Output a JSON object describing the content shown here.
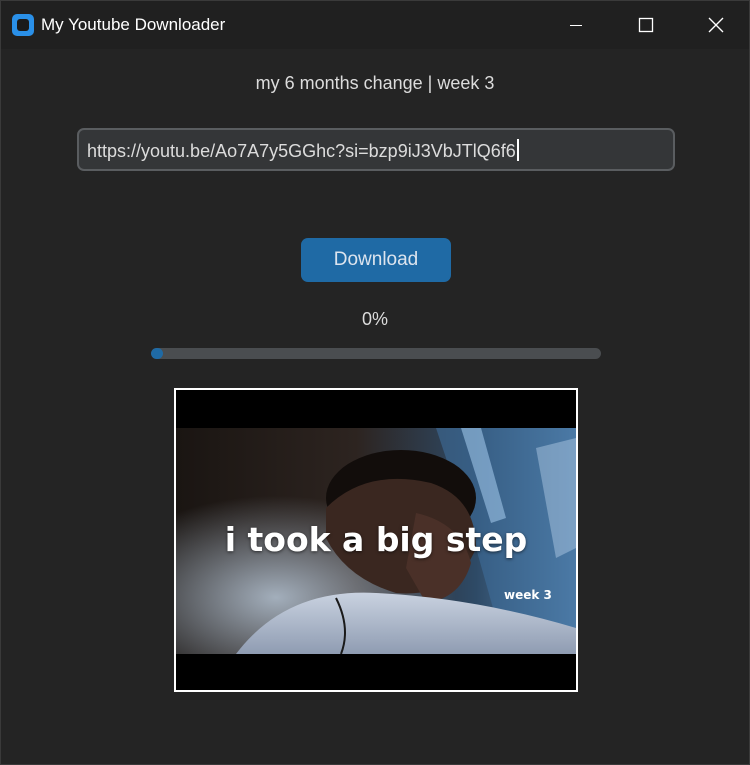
{
  "window": {
    "title": "My Youtube Downloader",
    "icon": "app-icon",
    "controls": [
      "minimize-icon",
      "maximize-icon",
      "close-icon"
    ]
  },
  "video": {
    "title": "my 6 months change | week 3"
  },
  "url_input": {
    "value": "https://youtu.be/Ao7A7y5GGhc?si=bzp9iJ3VbJTlQ6f6"
  },
  "download_button": {
    "label": "Download"
  },
  "progress": {
    "label": "0%",
    "value": 0
  },
  "thumbnail": {
    "caption": "i took a big step",
    "tag": "week 3"
  },
  "colors": {
    "background": "#242424",
    "titlebar": "#202020",
    "accent": "#1f6aa5",
    "input_bg": "#343638",
    "input_border": "#5a5d60",
    "track": "#4a4d50"
  }
}
